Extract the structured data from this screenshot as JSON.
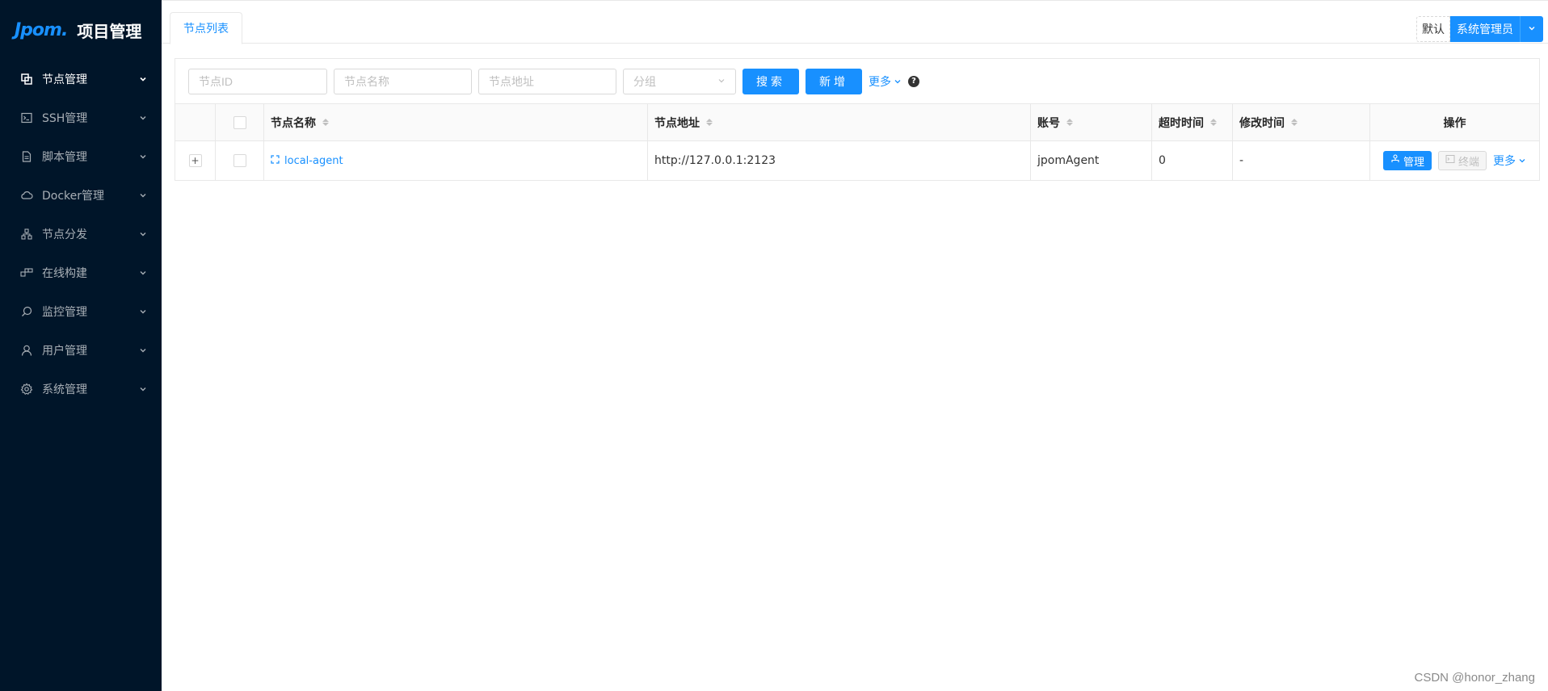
{
  "app": {
    "logo_text": "Jpom",
    "logo_dot": ".",
    "title": "项目管理"
  },
  "sidebar": {
    "items": [
      {
        "label": "节点管理",
        "icon": "nodes-icon",
        "active": true
      },
      {
        "label": "SSH管理",
        "icon": "terminal-icon"
      },
      {
        "label": "脚本管理",
        "icon": "file-icon"
      },
      {
        "label": "Docker管理",
        "icon": "cloud-icon"
      },
      {
        "label": "节点分发",
        "icon": "cluster-icon"
      },
      {
        "label": "在线构建",
        "icon": "build-icon"
      },
      {
        "label": "监控管理",
        "icon": "monitor-icon"
      },
      {
        "label": "用户管理",
        "icon": "user-icon"
      },
      {
        "label": "系统管理",
        "icon": "gear-icon"
      }
    ]
  },
  "header": {
    "tab": "节点列表",
    "workspace": "默认",
    "user": "系统管理员"
  },
  "search": {
    "node_id_placeholder": "节点ID",
    "node_name_placeholder": "节点名称",
    "node_addr_placeholder": "节点地址",
    "group_placeholder": "分组",
    "search_label": "搜索",
    "add_label": "新增",
    "more_label": "更多",
    "help": "?"
  },
  "table": {
    "columns": {
      "name": "节点名称",
      "addr": "节点地址",
      "account": "账号",
      "timeout": "超时时间",
      "modified": "修改时间",
      "ops": "操作"
    },
    "rows": [
      {
        "name": "local-agent",
        "addr": "http://127.0.0.1:2123",
        "account": "jpomAgent",
        "timeout": "0",
        "modified": "-",
        "manage_label": "管理",
        "terminal_label": "终端",
        "more_label": "更多"
      }
    ]
  },
  "watermark": "CSDN @honor_zhang",
  "colors": {
    "sidebar_bg": "#001529",
    "primary": "#1890ff"
  }
}
